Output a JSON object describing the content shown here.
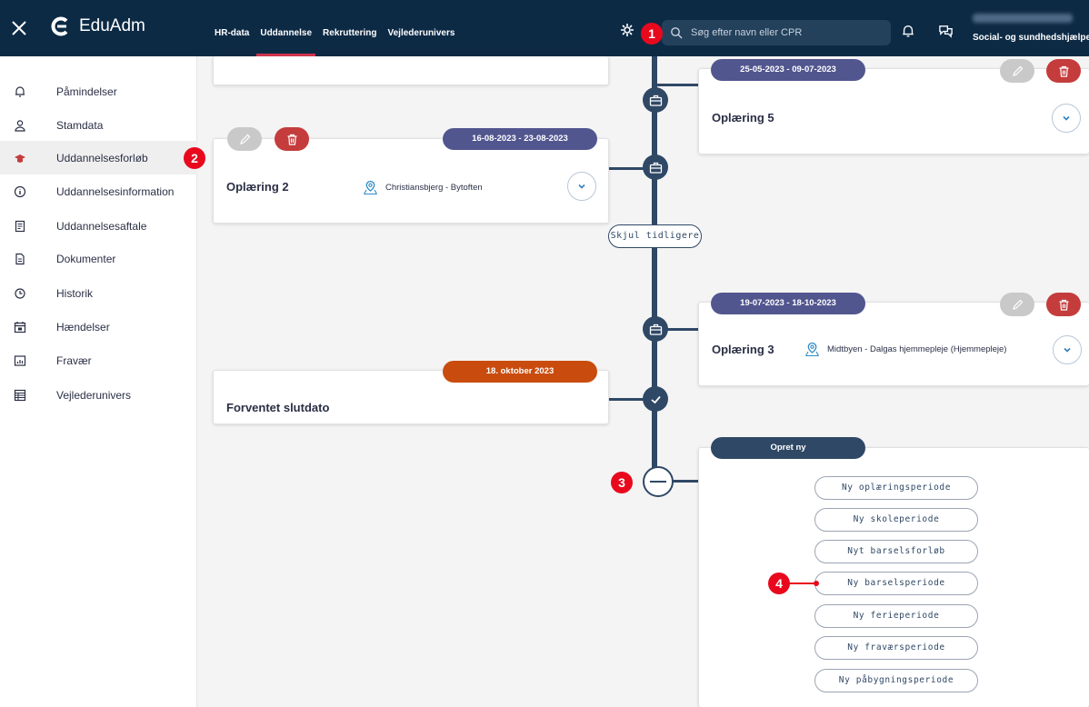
{
  "app": {
    "name": "EduAdm"
  },
  "topbar": {
    "nav": [
      "HR-data",
      "Uddannelse",
      "Rekruttering",
      "Vejlederunivers"
    ],
    "active_nav": "Uddannelse",
    "search_placeholder": "Søg efter navn eller CPR",
    "user_role": "Social- og sundhedshjælper"
  },
  "sidebar": {
    "items": [
      {
        "label": "Påmindelser",
        "icon": "bell-icon"
      },
      {
        "label": "Stamdata",
        "icon": "person-icon"
      },
      {
        "label": "Uddannelsesforløb",
        "icon": "graduation-cap-icon"
      },
      {
        "label": "Uddannelsesinformation",
        "icon": "info-icon"
      },
      {
        "label": "Uddannelsesaftale",
        "icon": "agreement-icon"
      },
      {
        "label": "Dokumenter",
        "icon": "document-icon"
      },
      {
        "label": "Historik",
        "icon": "clock-icon"
      },
      {
        "label": "Hændelser",
        "icon": "calendar-icon"
      },
      {
        "label": "Fravær",
        "icon": "chart-icon"
      },
      {
        "label": "Vejlederunivers",
        "icon": "table-icon"
      }
    ],
    "active_index": 2
  },
  "timeline": {
    "hide_button": "Skjul tidligere",
    "cards": {
      "oplaering5": {
        "date": "25-05-2023 - 09-07-2023",
        "title": "Oplæring 5"
      },
      "oplaering2": {
        "date": "16-08-2023 - 23-08-2023",
        "title": "Oplæring 2",
        "location": "Christiansbjerg - Bytoften"
      },
      "oplaering3": {
        "date": "19-07-2023 - 18-10-2023",
        "title": "Oplæring 3",
        "location": "Midtbyen - Dalgas hjemmepleje (Hjemmepleje)"
      },
      "slutdato": {
        "date": "18. oktober 2023",
        "title": "Forventet slutdato"
      }
    },
    "create": {
      "title": "Opret ny",
      "options": [
        "Ny oplæringsperiode",
        "Ny skoleperiode",
        "Nyt barselsforløb",
        "Ny barselsperiode",
        "Ny ferieperiode",
        "Ny fraværsperiode",
        "Ny påbygningsperiode"
      ]
    }
  },
  "annotations": [
    "1",
    "2",
    "3",
    "4"
  ],
  "colors": {
    "topbar": "#0d2a45",
    "timeline": "#2f4866",
    "pill_purple": "#52568f",
    "pill_orange": "#c94c0e",
    "delete_red": "#c43c3c",
    "annotation_red": "#e8091d"
  }
}
